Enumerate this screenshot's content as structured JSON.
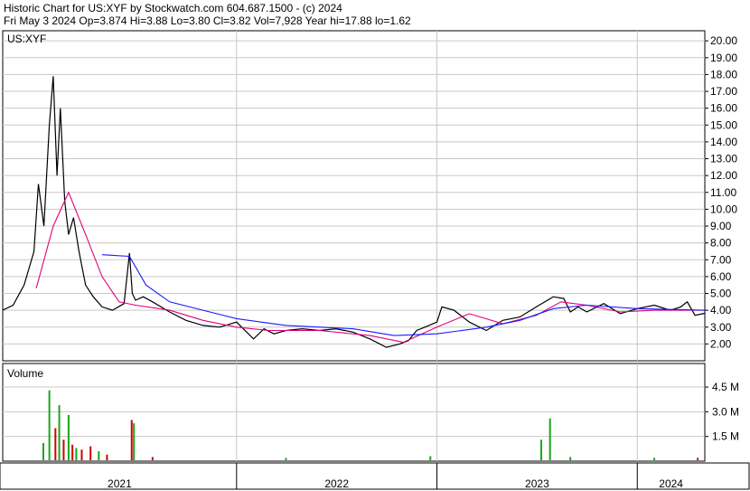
{
  "header": {
    "line1": "Historic Chart for US:XYF by Stockwatch.com 604.687.1500 - (c) 2024",
    "line2": "Fri May  3 2024  Op=3.874  Hi=3.88  Lo=3.80  Cl=3.82  Vol=7,928  Year hi=17.88  lo=1.62"
  },
  "colors": {
    "price": "#000000",
    "ma_short": "#e0007a",
    "ma_long": "#1a1aff",
    "volume_up": "#1aa61a",
    "volume_down": "#d00000",
    "grid": "#c8c8c8"
  },
  "chart_data": [
    {
      "type": "line",
      "panel_label": "US:XYF",
      "yticks": [
        "2.00",
        "3.00",
        "4.00",
        "5.00",
        "6.00",
        "7.00",
        "8.00",
        "9.00",
        "10.00",
        "11.00",
        "12.00",
        "13.00",
        "14.00",
        "15.00",
        "16.00",
        "17.00",
        "18.00",
        "19.00",
        "20.00"
      ],
      "ylim": [
        1,
        20.6
      ],
      "x_labels": [
        "2021",
        "2022",
        "2023",
        "2024"
      ],
      "x_dividers": [
        "2022-01-01",
        "2023-01-01",
        "2024-01-01"
      ],
      "xlim": [
        "2020-11-01",
        "2024-05-03"
      ],
      "series": [
        {
          "role": "price",
          "x": [
            "2020-11-01",
            "2020-11-20",
            "2020-12-10",
            "2020-12-28",
            "2021-01-05",
            "2021-01-15",
            "2021-01-25",
            "2021-02-01",
            "2021-02-08",
            "2021-02-14",
            "2021-02-22",
            "2021-03-01",
            "2021-03-10",
            "2021-03-20",
            "2021-04-01",
            "2021-04-15",
            "2021-05-01",
            "2021-05-20",
            "2021-06-10",
            "2021-06-20",
            "2021-06-25",
            "2021-07-01",
            "2021-07-15",
            "2021-08-01",
            "2021-09-01",
            "2021-10-01",
            "2021-11-01",
            "2021-12-01",
            "2022-01-01",
            "2022-02-01",
            "2022-02-20",
            "2022-03-10",
            "2022-04-01",
            "2022-05-01",
            "2022-06-01",
            "2022-07-01",
            "2022-08-01",
            "2022-09-01",
            "2022-10-01",
            "2022-10-25",
            "2022-11-10",
            "2022-11-25",
            "2022-12-10",
            "2023-01-01",
            "2023-01-10",
            "2023-02-01",
            "2023-03-01",
            "2023-04-01",
            "2023-05-01",
            "2023-06-01",
            "2023-07-01",
            "2023-08-01",
            "2023-08-20",
            "2023-09-01",
            "2023-09-15",
            "2023-10-01",
            "2023-11-01",
            "2023-12-01",
            "2024-01-01",
            "2024-02-01",
            "2024-03-01",
            "2024-03-20",
            "2024-04-01",
            "2024-04-15",
            "2024-05-03"
          ],
          "y": [
            4.0,
            4.3,
            5.5,
            7.5,
            11.5,
            9.0,
            15.0,
            17.9,
            12.0,
            16.0,
            10.5,
            8.5,
            9.5,
            7.5,
            5.5,
            4.8,
            4.2,
            4.0,
            4.4,
            7.4,
            5.0,
            4.6,
            4.8,
            4.5,
            3.9,
            3.4,
            3.1,
            3.0,
            3.3,
            2.3,
            2.9,
            2.6,
            2.8,
            2.9,
            2.8,
            2.9,
            2.7,
            2.3,
            1.8,
            2.0,
            2.2,
            2.8,
            3.0,
            3.3,
            4.2,
            4.0,
            3.3,
            2.8,
            3.4,
            3.6,
            4.2,
            4.8,
            4.7,
            3.9,
            4.2,
            3.9,
            4.4,
            3.8,
            4.1,
            4.3,
            4.0,
            4.2,
            4.5,
            3.7,
            3.82
          ]
        },
        {
          "role": "ma_short",
          "x": [
            "2021-01-01",
            "2021-02-01",
            "2021-03-01",
            "2021-04-01",
            "2021-05-01",
            "2021-06-01",
            "2021-07-01",
            "2021-09-01",
            "2021-11-01",
            "2022-01-01",
            "2022-03-01",
            "2022-06-01",
            "2022-09-01",
            "2022-11-01",
            "2023-01-01",
            "2023-03-01",
            "2023-05-01",
            "2023-07-01",
            "2023-08-15",
            "2023-10-01",
            "2023-12-01",
            "2024-02-01",
            "2024-05-03"
          ],
          "y": [
            5.3,
            9.0,
            11.0,
            8.5,
            6.0,
            4.5,
            4.3,
            4.0,
            3.4,
            3.0,
            2.8,
            2.8,
            2.5,
            2.1,
            3.0,
            3.8,
            3.2,
            3.7,
            4.5,
            4.3,
            3.9,
            4.0,
            4.0
          ]
        },
        {
          "role": "ma_long",
          "x": [
            "2021-05-01",
            "2021-06-20",
            "2021-07-20",
            "2021-09-01",
            "2021-11-01",
            "2022-01-01",
            "2022-04-01",
            "2022-08-01",
            "2022-10-15",
            "2023-01-01",
            "2023-04-01",
            "2023-06-01",
            "2023-08-01",
            "2023-10-01",
            "2024-01-01",
            "2024-05-03"
          ],
          "y": [
            7.3,
            7.2,
            5.5,
            4.5,
            4.0,
            3.5,
            3.1,
            2.9,
            2.5,
            2.6,
            3.0,
            3.4,
            4.1,
            4.3,
            4.1,
            4.0
          ]
        }
      ]
    },
    {
      "type": "bar",
      "panel_label": "Volume",
      "yticks": [
        "1.5 M",
        "3.0 M",
        "4.5 M"
      ],
      "ylim_millions": [
        0,
        5.6
      ],
      "bars": [
        {
          "x": "2021-01-14",
          "v": 1.1,
          "up": true
        },
        {
          "x": "2021-01-25",
          "v": 4.3,
          "up": true
        },
        {
          "x": "2021-02-05",
          "v": 2.0,
          "up": false
        },
        {
          "x": "2021-02-12",
          "v": 3.4,
          "up": true
        },
        {
          "x": "2021-02-20",
          "v": 1.3,
          "up": false
        },
        {
          "x": "2021-03-01",
          "v": 2.8,
          "up": true
        },
        {
          "x": "2021-03-08",
          "v": 1.0,
          "up": false
        },
        {
          "x": "2021-03-15",
          "v": 0.8,
          "up": true
        },
        {
          "x": "2021-03-25",
          "v": 0.7,
          "up": false
        },
        {
          "x": "2021-04-10",
          "v": 0.9,
          "up": false
        },
        {
          "x": "2021-04-25",
          "v": 0.6,
          "up": true
        },
        {
          "x": "2021-05-10",
          "v": 0.4,
          "up": false
        },
        {
          "x": "2021-06-24",
          "v": 2.5,
          "up": false
        },
        {
          "x": "2021-06-28",
          "v": 2.3,
          "up": true
        },
        {
          "x": "2021-08-01",
          "v": 0.25,
          "up": false
        },
        {
          "x": "2022-04-01",
          "v": 0.2,
          "up": true
        },
        {
          "x": "2022-12-20",
          "v": 0.3,
          "up": true
        },
        {
          "x": "2023-07-10",
          "v": 1.3,
          "up": true
        },
        {
          "x": "2023-07-26",
          "v": 2.6,
          "up": true
        },
        {
          "x": "2023-09-01",
          "v": 0.25,
          "up": true
        },
        {
          "x": "2024-02-01",
          "v": 0.2,
          "up": true
        },
        {
          "x": "2024-04-20",
          "v": 0.2,
          "up": false
        }
      ]
    }
  ]
}
